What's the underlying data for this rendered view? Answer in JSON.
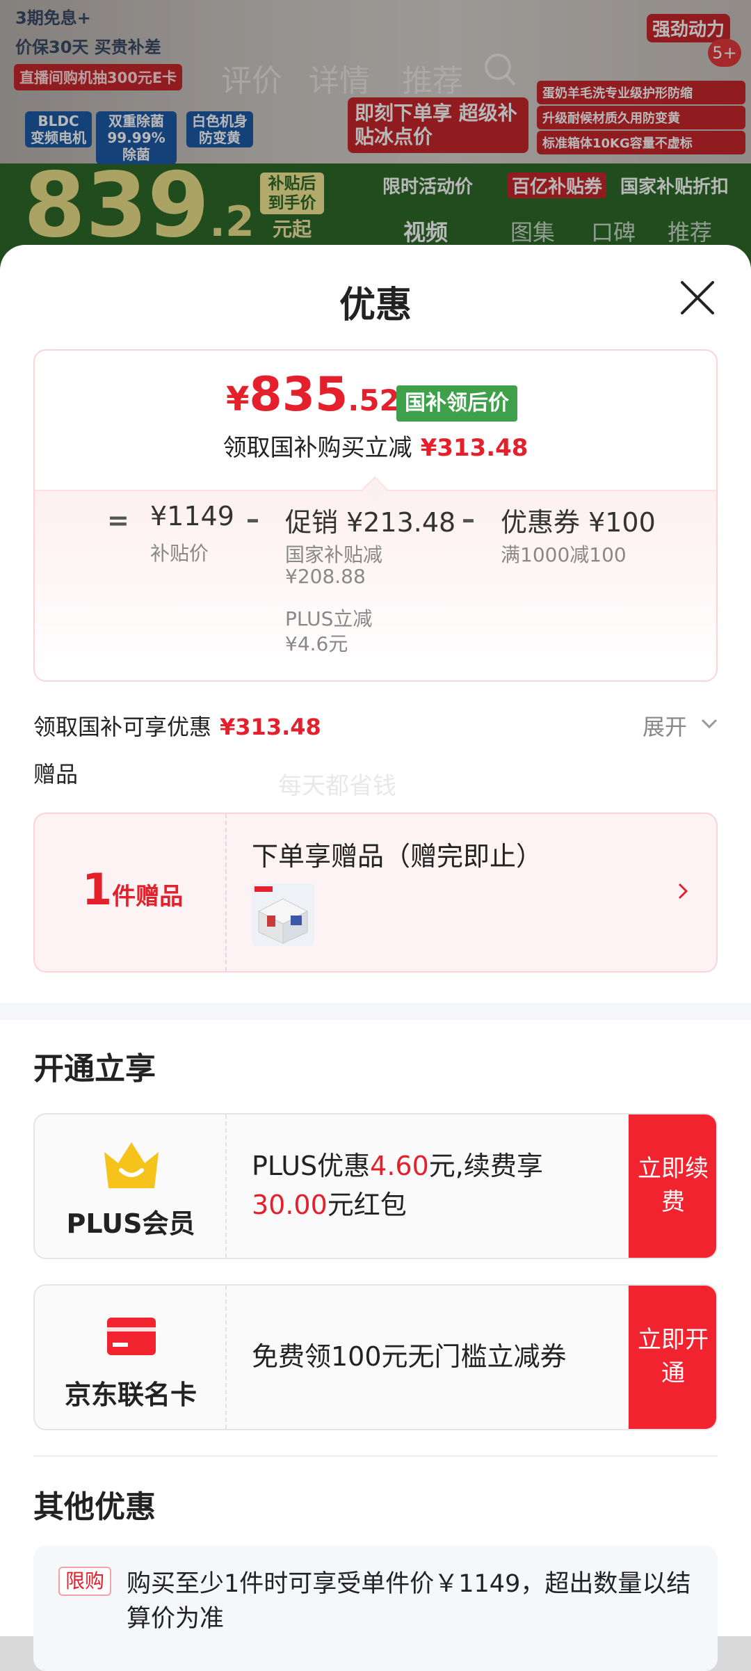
{
  "background": {
    "promo_lines": [
      "3期免息+",
      "价保30天 买贵补差",
      "直播间购机抽300元E卡"
    ],
    "feature_tags": [
      "BLDC 变频电机",
      "双重除菌 99.99%除菌",
      "白色机身 防变黄"
    ],
    "slogan": "即刻下单享 超级补贴冰点价",
    "right_bullets": [
      "强劲动力",
      "蛋奶羊毛洗专业级护形防缩",
      "升级耐候材质久用防变黄",
      "标准箱体10KG容量不虚标"
    ],
    "nav_items": [
      "评价",
      "详情",
      "推荐"
    ],
    "cart_badge": "5+",
    "price_int": "839",
    "price_dec": ".2",
    "price_note": "补贴后 到手价",
    "price_unit": "元起",
    "pills": [
      "限时活动价",
      "百亿补贴券",
      "国家补贴折扣"
    ],
    "media_tabs": [
      "视频",
      "图集",
      "口碑",
      "推荐"
    ]
  },
  "sheet": {
    "title": "优惠",
    "close_icon": "close-icon"
  },
  "price_card": {
    "currency": "¥",
    "price_int": "835",
    "price_dec": ".52",
    "price_tag": "国补领后价",
    "reduce_label": "领取国补购买立减",
    "reduce_amount": "¥313.48",
    "equal_sign": "=",
    "minus_sign": "–",
    "base_price": "¥1149",
    "base_label": "补贴价",
    "promo_label": "促销 ¥213.48",
    "promo_detail_1_label": "国家补贴减",
    "promo_detail_1_value": "¥208.88",
    "promo_detail_2_label": "PLUS立减",
    "promo_detail_2_value": "¥4.6元",
    "coupon_label": "优惠券 ¥100",
    "coupon_detail": "满1000减100"
  },
  "discount_row": {
    "label": "领取国补可享优惠",
    "amount": "¥313.48",
    "expand_label": "展开"
  },
  "gifts": {
    "section_label": "赠品",
    "watermark": "每天都省钱",
    "count": "1",
    "count_unit": "件赠品",
    "title": "下单享赠品（赠完即止）"
  },
  "membership": {
    "section_title": "开通立享",
    "plus": {
      "name": "PLUS会员",
      "text_1": "PLUS优惠",
      "amount_1": "4.60",
      "text_2": "元,续费享",
      "amount_2": "30.00",
      "text_3": "元红包",
      "button": "立即续费"
    },
    "card": {
      "name": "京东联名卡",
      "text": "免费领100元无门槛立减券",
      "button": "立即开通"
    }
  },
  "other": {
    "section_title": "其他优惠",
    "limit_tag": "限购",
    "limit_text": "购买至少1件时可享受单件价￥1149，超出数量以结算价为准"
  },
  "colors": {
    "accent_red": "#e3202b",
    "green_tag": "#3ea04a",
    "plus_gold": "#f6c21c",
    "card_red": "#f0232f"
  }
}
